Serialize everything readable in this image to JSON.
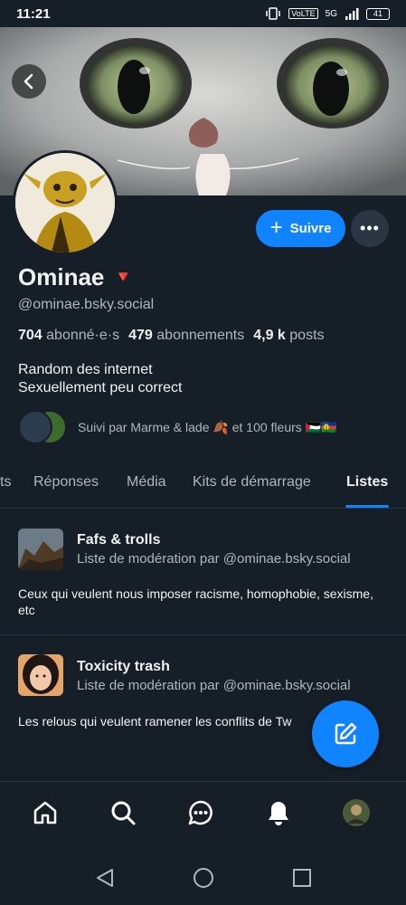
{
  "status_bar": {
    "time": "11:21",
    "network": "VoLTE",
    "signal_label": "5G",
    "battery": "41"
  },
  "profile": {
    "display_name": "Ominae",
    "name_emoji": "🔻",
    "handle": "@ominae.bsky.social",
    "follow_label": "Suivre",
    "more_label": "•••",
    "stats": {
      "followers_count": "704",
      "followers_label": "abonné·e·s",
      "following_count": "479",
      "following_label": "abonnements",
      "posts_count": "4,9 k",
      "posts_label": "posts"
    },
    "bio_line1": "Random des internet",
    "bio_line2": "Sexuellement peu correct",
    "followed_by": "Suivi par Marme & lade 🍂 et 100 fleurs 🇵🇸🇳🇨"
  },
  "tabs": [
    {
      "label": "ts"
    },
    {
      "label": "Réponses"
    },
    {
      "label": "Média"
    },
    {
      "label": "Kits de démarrage"
    },
    {
      "label": "Listes",
      "active": true
    }
  ],
  "lists": [
    {
      "title": "Fafs & trolls",
      "subtitle": "Liste de modération par @ominae.bsky.social",
      "description": "Ceux qui veulent nous imposer racisme, homophobie, sexisme, etc"
    },
    {
      "title": "Toxicity trash",
      "subtitle": "Liste de modération par @ominae.bsky.social",
      "description": "Les relous qui veulent ramener les conflits de Tw"
    }
  ],
  "icons": {
    "back": "back-arrow-icon",
    "fab": "compose-icon",
    "nav": [
      "home-icon",
      "search-icon",
      "chat-icon",
      "bell-icon",
      "profile-avatar"
    ],
    "system": [
      "system-back-icon",
      "system-home-icon",
      "system-recents-icon"
    ]
  },
  "colors": {
    "accent": "#1083fe",
    "background": "#161e27",
    "muted": "#aeb7c1"
  }
}
